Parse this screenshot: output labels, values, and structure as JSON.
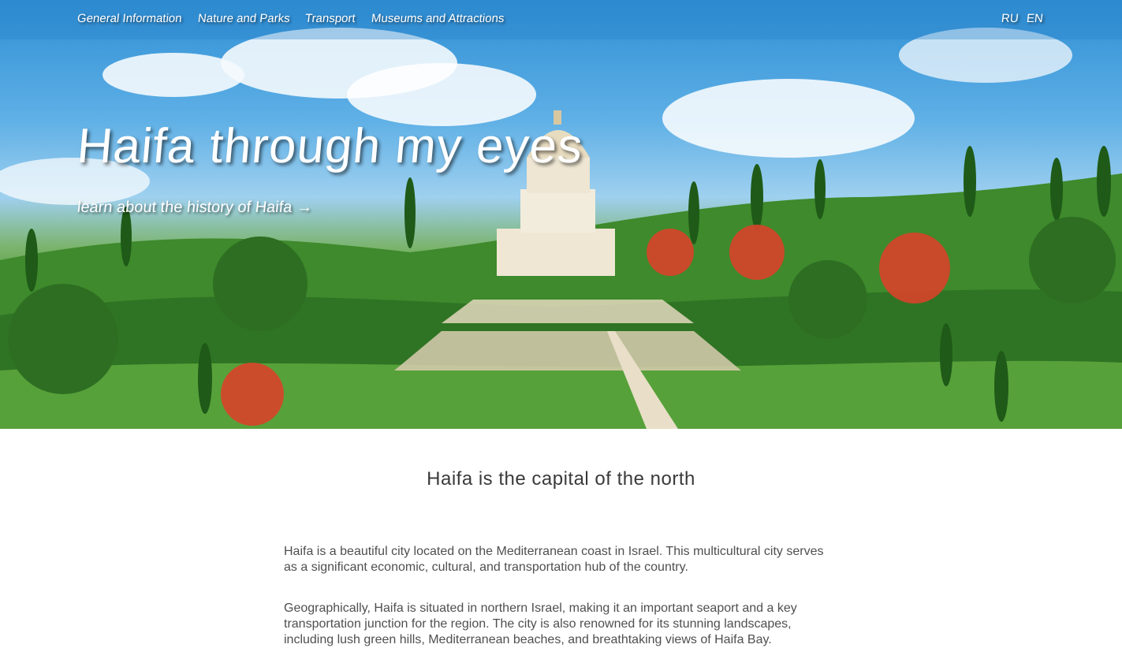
{
  "nav": {
    "items": [
      {
        "label": "General Information"
      },
      {
        "label": "Nature and Parks"
      },
      {
        "label": "Transport"
      },
      {
        "label": "Museums and Attractions"
      }
    ]
  },
  "lang": {
    "ru": "RU",
    "en": "EN"
  },
  "hero": {
    "title": "Haifa through my eyes",
    "link_label": "learn about the history of Haifa",
    "link_arrow": "→",
    "image": "Bahá'í Gardens and Shrine on Mount Carmel"
  },
  "content": {
    "title": "Haifa is the capital of the north",
    "paragraphs": [
      "Haifa is a beautiful city located on the Mediterranean coast in Israel. This multicultural city serves as a significant economic, cultural, and transportation hub of the country.",
      "Geographically, Haifa is situated in northern Israel, making it an important seaport and a key transportation junction for the region. The city is also renowned for its stunning landscapes, including lush green hills, Mediterranean beaches, and breathtaking views of Haifa Bay."
    ]
  },
  "colors": {
    "topbar": "#2882c8",
    "text": "#4f4f4f",
    "heading": "#3a3a3a"
  }
}
